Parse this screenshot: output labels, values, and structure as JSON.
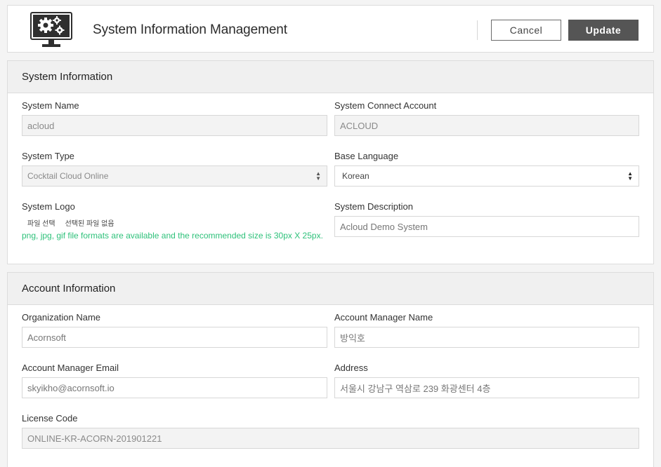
{
  "header": {
    "title": "System Information Management",
    "cancel_label": "Cancel",
    "update_label": "Update",
    "icon": "settings-monitor-icon"
  },
  "system": {
    "section_title": "System Information",
    "name": {
      "label": "System Name",
      "value": "acloud"
    },
    "connect_account": {
      "label": "System Connect Account",
      "value": "ACLOUD"
    },
    "type": {
      "label": "System Type",
      "value": "Cocktail Cloud Online"
    },
    "language": {
      "label": "Base Language",
      "value": "Korean"
    },
    "logo": {
      "label": "System Logo",
      "choose_label": "파일 선택",
      "no_file_label": "선택된 파일 없음",
      "hint": "png, jpg, gif file formats are available and the recommended size is 30px X 25px."
    },
    "description": {
      "label": "System Description",
      "value": "Acloud Demo System"
    }
  },
  "account": {
    "section_title": "Account Information",
    "organization": {
      "label": "Organization Name",
      "value": "Acornsoft"
    },
    "manager_name": {
      "label": "Account Manager Name",
      "value": "방익호"
    },
    "manager_email": {
      "label": "Account Manager Email",
      "value": "skyikho@acornsoft.io"
    },
    "address": {
      "label": "Address",
      "value": "서울시 강남구 역삼로 239 화광센터 4층"
    },
    "license": {
      "label": "License Code",
      "value": "ONLINE-KR-ACORN-201901221"
    }
  },
  "colors": {
    "accent_green": "#2ec17a",
    "update_button": "#555555"
  }
}
